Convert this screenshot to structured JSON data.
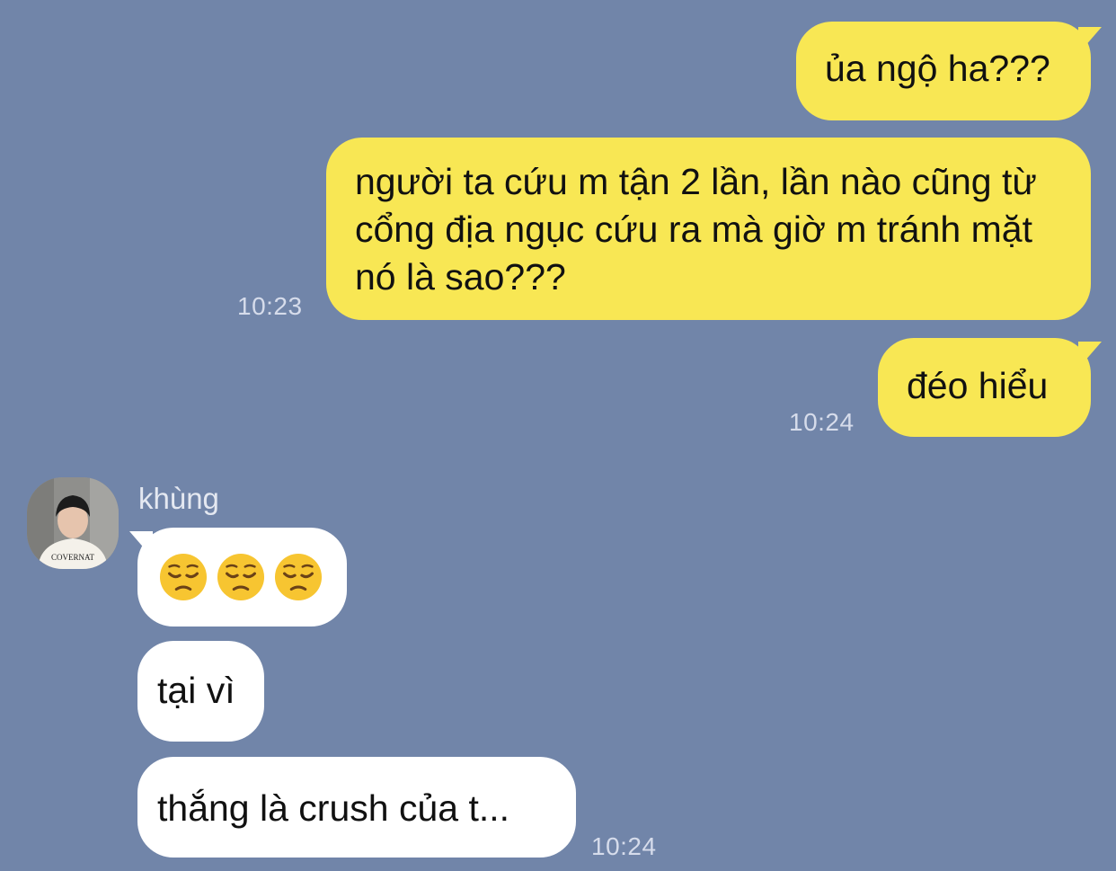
{
  "messages_out": [
    {
      "text": "ủa ngộ ha???"
    },
    {
      "text": "người ta cứu m tận 2 lần, lần nào cũng từ cổng địa ngục cứu ra mà giờ m tránh mặt nó là sao???",
      "time": "10:23"
    },
    {
      "text": "đéo hiểu",
      "time": "10:24"
    }
  ],
  "incoming": {
    "sender_name": "khùng",
    "avatar_shirt_text": "COVERNAT",
    "messages": [
      {
        "emoji": "pensive-face",
        "count": 3
      },
      {
        "text": "tại vì"
      },
      {
        "text": "thắng là crush của t...",
        "time": "10:24"
      }
    ]
  },
  "colors": {
    "background": "#7185a9",
    "outgoing_bubble": "#f8e754",
    "incoming_bubble": "#ffffff",
    "timestamp": "#d6dceb"
  }
}
